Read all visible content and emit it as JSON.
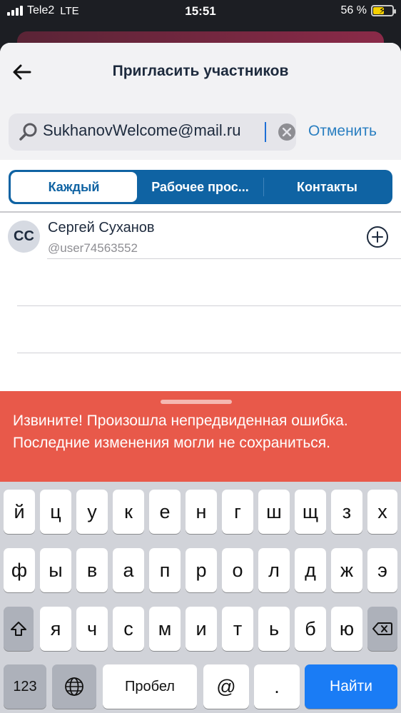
{
  "status_bar": {
    "carrier": "Tele2",
    "network": "LTE",
    "time": "15:51",
    "battery_percent_text": "56 %",
    "battery_level": 0.56
  },
  "nav": {
    "title": "Пригласить участников",
    "back_icon": "arrow-left-icon"
  },
  "search": {
    "value": "SukhanovWelcome@mail.ru",
    "cancel_label": "Отменить"
  },
  "segments": {
    "items": [
      "Каждый",
      "Рабочее прос...",
      "Контакты"
    ],
    "active_index": 0
  },
  "contacts": [
    {
      "initials": "СС",
      "name": "Сергей Суханов",
      "handle": "@user74563552"
    }
  ],
  "error_banner": {
    "text": "Извините! Произошла непредвиденная ошибка. Последние изменения могли не сохраниться."
  },
  "keyboard": {
    "row1": [
      "й",
      "ц",
      "у",
      "к",
      "е",
      "н",
      "г",
      "ш",
      "щ",
      "з",
      "х"
    ],
    "row2": [
      "ф",
      "ы",
      "в",
      "а",
      "п",
      "р",
      "о",
      "л",
      "д",
      "ж",
      "э"
    ],
    "row3": [
      "я",
      "ч",
      "с",
      "м",
      "и",
      "т",
      "ь",
      "б",
      "ю"
    ],
    "numbers_label": "123",
    "space_label": "Пробел",
    "at_label": "@",
    "dot_label": ".",
    "go_label": "Найти"
  },
  "colors": {
    "accent": "#0f63a3",
    "error": "#e8594a",
    "keyboard_go": "#1a7cf5"
  }
}
